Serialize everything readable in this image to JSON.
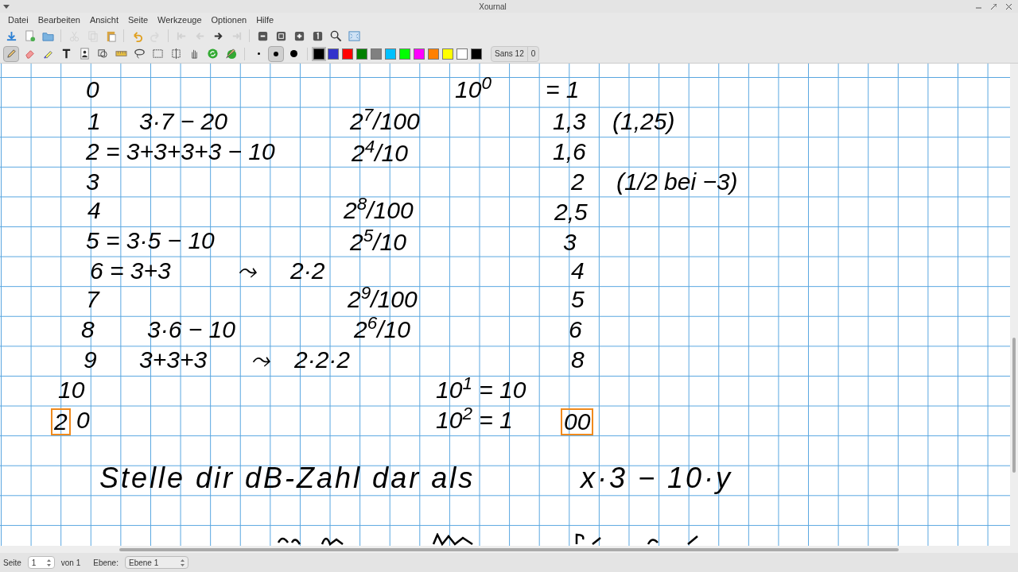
{
  "window": {
    "title": "Xournal"
  },
  "menu": [
    "Datei",
    "Bearbeiten",
    "Ansicht",
    "Seite",
    "Werkzeuge",
    "Optionen",
    "Hilfe"
  ],
  "toolbar": [
    {
      "kind": "save",
      "disabled": false
    },
    {
      "kind": "new",
      "disabled": false
    },
    {
      "kind": "open",
      "disabled": false
    },
    {
      "kind": "sep"
    },
    {
      "kind": "cut",
      "disabled": true
    },
    {
      "kind": "copy",
      "disabled": true
    },
    {
      "kind": "paste",
      "disabled": false
    },
    {
      "kind": "sep"
    },
    {
      "kind": "undo",
      "disabled": false
    },
    {
      "kind": "redo",
      "disabled": true
    },
    {
      "kind": "sep"
    },
    {
      "kind": "first",
      "disabled": true
    },
    {
      "kind": "prev",
      "disabled": true
    },
    {
      "kind": "next",
      "disabled": false
    },
    {
      "kind": "last",
      "disabled": true
    },
    {
      "kind": "sep"
    },
    {
      "kind": "zoomout",
      "disabled": false
    },
    {
      "kind": "fit",
      "disabled": false
    },
    {
      "kind": "zoomin",
      "disabled": false
    },
    {
      "kind": "one",
      "disabled": false
    },
    {
      "kind": "zoom",
      "disabled": false
    },
    {
      "kind": "fullscreen",
      "disabled": false
    }
  ],
  "tools": [
    {
      "kind": "pen",
      "selected": true
    },
    {
      "kind": "eraser",
      "selected": false
    },
    {
      "kind": "highlighter",
      "selected": false
    },
    {
      "kind": "text",
      "selected": false
    },
    {
      "kind": "image",
      "selected": false
    },
    {
      "kind": "shape",
      "selected": false
    },
    {
      "kind": "ruler",
      "selected": false
    },
    {
      "kind": "lasso",
      "selected": false
    },
    {
      "kind": "rectsel",
      "selected": false
    },
    {
      "kind": "vspace",
      "selected": false
    },
    {
      "kind": "hand",
      "selected": false
    },
    {
      "kind": "default",
      "selected": false
    },
    {
      "kind": "defpen",
      "selected": false
    }
  ],
  "thickness": [
    {
      "kind": "fine",
      "selected": false
    },
    {
      "kind": "medium",
      "selected": true
    },
    {
      "kind": "thick",
      "selected": false
    }
  ],
  "colors": [
    {
      "color": "#000000",
      "selected": true
    },
    {
      "color": "#3333cc",
      "selected": false
    },
    {
      "color": "#ff0000",
      "selected": false
    },
    {
      "color": "#008000",
      "selected": false
    },
    {
      "color": "#808080",
      "selected": false
    },
    {
      "color": "#00c0ff",
      "selected": false
    },
    {
      "color": "#00ff00",
      "selected": false
    },
    {
      "color": "#ff00ff",
      "selected": false
    },
    {
      "color": "#ff8000",
      "selected": false
    },
    {
      "color": "#ffff00",
      "selected": false
    },
    {
      "color": "#ffffff",
      "selected": false
    },
    {
      "color": "#000000",
      "selected": false
    }
  ],
  "font_button": "Sans 12",
  "font_size_field": "0",
  "notes": [
    {
      "text": "0",
      "color": "#000000",
      "highlight": false
    },
    {
      "text": "1",
      "color": "#000000",
      "highlight": false
    },
    {
      "text": "3·7 − 20",
      "color": "#000000",
      "highlight": false
    },
    {
      "text": "2 = 3+3+3+3 − 10",
      "color": "#000000",
      "highlight": false
    },
    {
      "text": "3",
      "color": "#000000",
      "highlight": false
    },
    {
      "text": "4",
      "color": "#000000",
      "highlight": false
    },
    {
      "text": "5 = 3·5 − 10",
      "color": "#000000",
      "highlight": false
    },
    {
      "text": "6 = 3+3",
      "color": "#000000",
      "highlight": false
    },
    {
      "text": "⤳",
      "color": "#000000",
      "highlight": false
    },
    {
      "text": "2·2",
      "color": "#000000",
      "highlight": false
    },
    {
      "text": "7",
      "color": "#000000",
      "highlight": false
    },
    {
      "text": "8",
      "color": "#000000",
      "highlight": false
    },
    {
      "text": "3·6 − 10",
      "color": "#000000",
      "highlight": false
    },
    {
      "text": "9",
      "color": "#000000",
      "highlight": false
    },
    {
      "text": "3+3+3",
      "color": "#000000",
      "highlight": false
    },
    {
      "text": "⤳",
      "color": "#000000",
      "highlight": false
    },
    {
      "text": "2·2·2",
      "color": "#000000",
      "highlight": false
    },
    {
      "text": "10",
      "color": "#000000",
      "highlight": false
    },
    {
      "text": "2",
      "color": "#000000",
      "highlight": true
    },
    {
      "text": "0",
      "color": "#000000",
      "highlight": false
    },
    {
      "text": "2$^{7}$/100",
      "color": "#000000",
      "highlight": false
    },
    {
      "text": "2$^{4}$/10",
      "color": "#000000",
      "highlight": false
    },
    {
      "text": "2$^{8}$/100",
      "color": "#000000",
      "highlight": false
    },
    {
      "text": "2$^{5}$/10",
      "color": "#000000",
      "highlight": false
    },
    {
      "text": "2$^{9}$/100",
      "color": "#000000",
      "highlight": false
    },
    {
      "text": "2$^{6}$/10",
      "color": "#000000",
      "highlight": false
    },
    {
      "text": "10$^{0}$",
      "color": "#000000",
      "highlight": false
    },
    {
      "text": "= 1",
      "color": "#000000",
      "highlight": false
    },
    {
      "text": "1,3",
      "color": "#000000",
      "highlight": false
    },
    {
      "text": "(1,25)",
      "color": "#000000",
      "highlight": false
    },
    {
      "text": "1,6",
      "color": "#000000",
      "highlight": false
    },
    {
      "text": "2",
      "color": "#000000",
      "highlight": false
    },
    {
      "text": "(1/2 bei −3)",
      "color": "#000000",
      "highlight": false
    },
    {
      "text": "2,5",
      "color": "#000000",
      "highlight": false
    },
    {
      "text": "3",
      "color": "#000000",
      "highlight": false
    },
    {
      "text": "4",
      "color": "#000000",
      "highlight": false
    },
    {
      "text": "5",
      "color": "#000000",
      "highlight": false
    },
    {
      "text": "6",
      "color": "#000000",
      "highlight": false
    },
    {
      "text": "8",
      "color": "#000000",
      "highlight": false
    },
    {
      "text": "10$^{1}$ = 10",
      "color": "#000000",
      "highlight": false
    },
    {
      "text": "10$^{2}$ = 1",
      "color": "#000000",
      "highlight": false
    },
    {
      "text": "00",
      "color": "#000000",
      "highlight": true
    },
    {
      "text": "Stelle dir dB-Zahl dar als",
      "color": "#000000",
      "highlight": false
    },
    {
      "text": "x·3 − 10·y",
      "color": "#000000",
      "highlight": false
    }
  ],
  "status_bar": {
    "page_label": "Seite",
    "page_field": "1",
    "page_of": "von 1",
    "layer_label": "Ebene:",
    "layer_select": "Ebene 1"
  }
}
